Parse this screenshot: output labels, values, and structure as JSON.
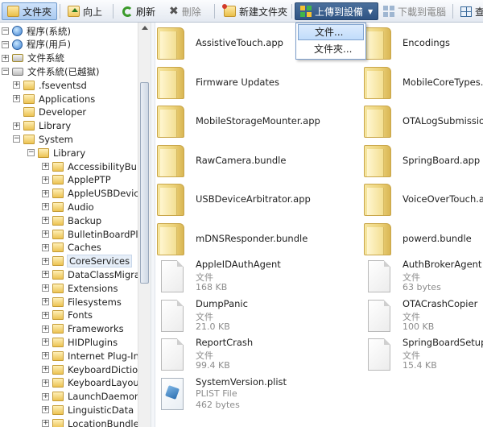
{
  "toolbar": {
    "folder_view": "文件夾",
    "up": "向上",
    "refresh": "刷新",
    "delete": "刪除",
    "new_folder": "新建文件夾",
    "upload": "上傳到設備",
    "download": "下載到電腦",
    "view": "查"
  },
  "upload_menu": {
    "items": [
      "文件...",
      "文件夾..."
    ]
  },
  "tree": {
    "nodes": [
      "程序(系統)",
      "程序(用戶)",
      "文件系統",
      "文件系統(已越獄)",
      ".fseventsd",
      "Applications",
      "Developer",
      "Library",
      "System",
      "Library",
      "AccessibilityBund",
      "ApplePTP",
      "AppleUSBDevice",
      "Audio",
      "Backup",
      "BulletinBoardPlu",
      "Caches",
      "CoreServices",
      "DataClassMigrato",
      "Extensions",
      "Filesystems",
      "Fonts",
      "Frameworks",
      "HIDPlugins",
      "Internet Plug-Ins",
      "KeyboardDiction",
      "KeyboardLayouts",
      "LaunchDaemons",
      "LinguisticData",
      "LocationBundles"
    ]
  },
  "files": [
    {
      "name": "AssistiveTouch.app"
    },
    {
      "name": "Encodings"
    },
    {
      "name": "Firmware Updates"
    },
    {
      "name": "MobileCoreTypes.bu"
    },
    {
      "name": "MobileStorageMounter.app"
    },
    {
      "name": "OTALogSubmission"
    },
    {
      "name": "RawCamera.bundle"
    },
    {
      "name": "SpringBoard.app"
    },
    {
      "name": "USBDeviceArbitrator.app"
    },
    {
      "name": "VoiceOverTouch.app"
    },
    {
      "name": "mDNSResponder.bundle"
    },
    {
      "name": "powerd.bundle"
    },
    {
      "name": "AppleIDAuthAgent",
      "type": "文件",
      "size": "168 KB"
    },
    {
      "name": "AuthBrokerAgent",
      "type": "文件",
      "size": "63 bytes"
    },
    {
      "name": "DumpPanic",
      "type": "文件",
      "size": "21.0 KB"
    },
    {
      "name": "OTACrashCopier",
      "type": "文件",
      "size": "100 KB"
    },
    {
      "name": "ReportCrash",
      "type": "文件",
      "size": "99.4 KB"
    },
    {
      "name": "SpringBoardSetupHe",
      "type": "文件",
      "size": "15.4 KB"
    },
    {
      "name": "SystemVersion.plist",
      "type": "PLIST File",
      "size": "462 bytes"
    }
  ]
}
